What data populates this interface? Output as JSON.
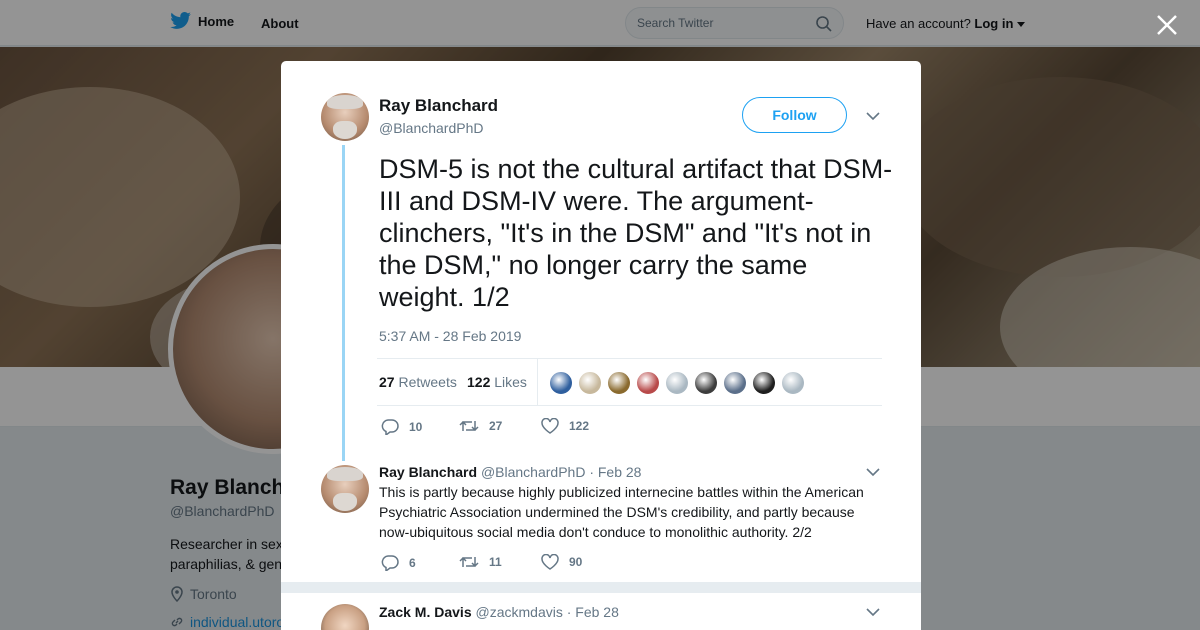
{
  "nav": {
    "home_label": "Home",
    "about_label": "About",
    "search_placeholder": "Search Twitter",
    "account_prompt": "Have an account?",
    "login_label": "Log in"
  },
  "profile": {
    "name": "Ray Blanchard",
    "handle": "@BlanchardPhD",
    "bio": "Researcher in sex paraphilias, & gen",
    "location": "Toronto",
    "link": "individual.utoro"
  },
  "main_tweet": {
    "author_name": "Ray Blanchard",
    "author_handle": "@BlanchardPhD",
    "follow_label": "Follow",
    "text": "DSM-5 is not the cultural artifact that DSM-III and DSM-IV were. The argument-clinchers, \"It's in the DSM\" and \"It's not in the DSM,\" no longer carry the same weight.  1/2",
    "timestamp": "5:37 AM - 28 Feb 2019",
    "retweets_count": "27",
    "retweets_label": "Retweets",
    "likes_count": "122",
    "likes_label": "Likes",
    "replies": "10",
    "retweets": "27",
    "likes": "122",
    "liker_colors": [
      "#2f5f9e",
      "#c7b89c",
      "#8a6a2e",
      "#b84a4a",
      "#aab8c2",
      "#3d3d3d",
      "#5b6f8a",
      "#1f1f1f",
      "#aab8c2"
    ]
  },
  "reply_tweet": {
    "author_name": "Ray Blanchard",
    "author_handle": "@BlanchardPhD",
    "date": "· Feb 28",
    "text": "This is partly because highly publicized internecine battles within the American Psychiatric Association undermined the DSM's credibility, and partly because now-ubiquitous social media don't conduce to monolithic authority.  2/2",
    "replies": "6",
    "retweets": "11",
    "likes": "90"
  },
  "next_tweet": {
    "author_name": "Zack M. Davis",
    "author_handle": "@zackmdavis",
    "date": "· Feb 28"
  },
  "colors": {
    "twitter_blue": "#1da1f2",
    "thread_line": "#9ad5f5",
    "muted_text": "#657786"
  }
}
